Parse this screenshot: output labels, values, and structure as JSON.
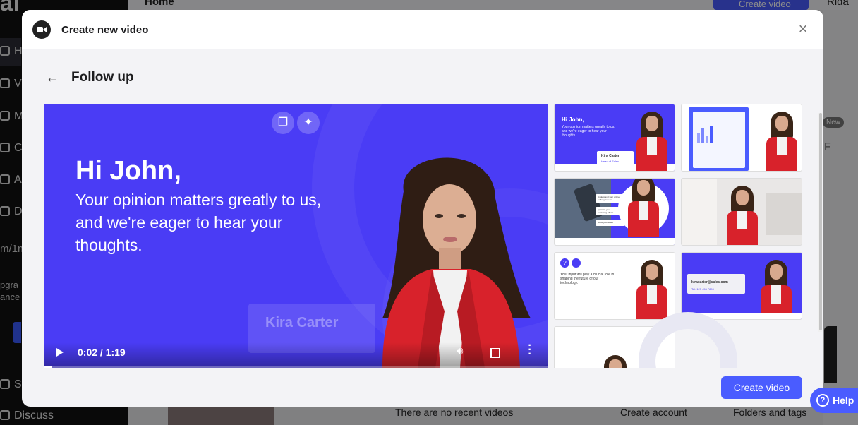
{
  "background": {
    "logo": "al",
    "nav_letters": [
      "H",
      "V",
      "M",
      "C",
      "A",
      "D"
    ],
    "snippet_1": "m/1m",
    "snippet_2": "pgra",
    "snippet_3": "ance",
    "nav_bottom_1": "S",
    "nav_bottom_2": "Discuss",
    "top_home": "Home",
    "top_create_btn": "Create video",
    "top_user": "Rida",
    "badge_new": "New",
    "right_letter": "F",
    "footer_recent": "There are no recent videos",
    "footer_account": "Create account",
    "footer_folders": "Folders and tags"
  },
  "modal": {
    "title": "Create new video",
    "close_icon": "close-icon",
    "subtitle": "Follow up",
    "back_icon": "arrow-left-icon"
  },
  "player": {
    "heading": "Hi John,",
    "body": "Your opinion matters greatly to us, and we're eager to hear your thoughts.",
    "name_card": "Kira Carter",
    "time": "0:02 / 1:19",
    "progress": 0.017,
    "icons": [
      "copy-icon",
      "sparkle-icon",
      "play-icon",
      "volume-icon",
      "fullscreen-icon",
      "more-icon"
    ]
  },
  "templates": [
    {
      "id": "t1",
      "lines": [
        "Hi John,",
        "Your opinion matters greatly to us,",
        "and we're eager to hear your",
        "thoughts."
      ],
      "card_name": "Kira Carter",
      "card_role": "Head of Sales"
    },
    {
      "id": "t2",
      "lines": []
    },
    {
      "id": "t3",
      "lines": [
        "Understand your online",
        "selling process",
        "optimize your",
        "marketing efforts",
        "boost your sales"
      ]
    },
    {
      "id": "t4",
      "lines": []
    },
    {
      "id": "t5",
      "lines": [
        "Your input will play a crucial role in",
        "shaping the future of our",
        "technology."
      ]
    },
    {
      "id": "t6",
      "lines": [
        "kiracarter@sales.com",
        "Tel. 123 456 7890"
      ]
    },
    {
      "id": "t7",
      "lines": []
    }
  ],
  "create_button": "Create video",
  "help_button": "Help",
  "colors": {
    "accent": "#4a5cff",
    "video_bg": "#4a3cf5",
    "jacket": "#d8222b"
  }
}
